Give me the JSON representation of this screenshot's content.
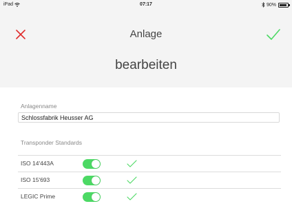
{
  "status_bar": {
    "device": "iPad",
    "time": "07:17",
    "battery_text": "90%",
    "battery_level": 0.9
  },
  "header": {
    "title_line1": "Anlage",
    "title_line2": "bearbeiten"
  },
  "colors": {
    "close": "#e02c2c",
    "confirm": "#4cd964",
    "toggle_on": "#4cd964",
    "header_bg": "#f4f4f4"
  },
  "form": {
    "name_label": "Anlagenname",
    "name_value": "Schlossfabrik Heusser AG",
    "standards_label": "Transponder Standards",
    "standards": [
      {
        "label": "ISO 14'443A",
        "enabled": true,
        "selected": true
      },
      {
        "label": "ISO 15'693",
        "enabled": true,
        "selected": true
      },
      {
        "label": "LEGIC Prime",
        "enabled": true,
        "selected": true
      }
    ]
  }
}
